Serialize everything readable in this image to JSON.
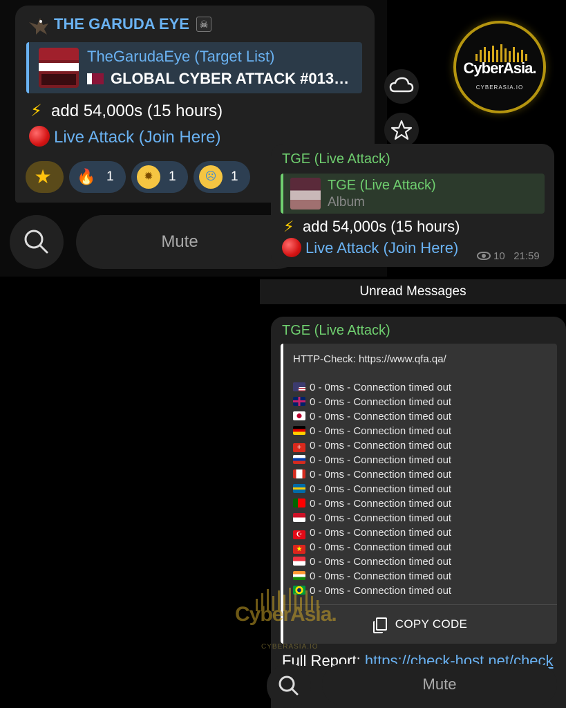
{
  "left_chat": {
    "channel_name": "THE GARUDA EYE",
    "reply": {
      "title": "TheGarudaEye (Target List)",
      "text": "GLOBAL CYBER ATTACK #013…"
    },
    "lines": [
      {
        "icon": "lightning-icon",
        "text": "add 54,000s (15 hours)"
      },
      {
        "icon": "red-circle-icon",
        "text": "Live Attack (Join Here)"
      }
    ],
    "reactions": [
      {
        "icon": "star-icon",
        "count": ""
      },
      {
        "icon": "fire-icon",
        "count": "1"
      },
      {
        "icon": "mind-blown-icon",
        "count": "1"
      },
      {
        "icon": "crying-icon",
        "count": "1"
      }
    ],
    "mute_label": "Mute"
  },
  "logo": {
    "brand": "CyberAsia.",
    "domain": "CYBERASIA.IO",
    "color": "#b5950f"
  },
  "right_chat": {
    "message1": {
      "sender": "TGE (Live Attack)",
      "reply_title": "TGE (Live Attack)",
      "reply_subtitle": "Album",
      "line1": "add 54,000s (15 hours)",
      "line2": "Live Attack (Join Here)",
      "views": "10",
      "time": "21:59"
    },
    "unread_label": "Unread Messages",
    "message2": {
      "sender": "TGE (Live Attack)",
      "code_header": "HTTP-Check: https://www.qfa.qa/",
      "rows": [
        {
          "flag": "us-flag-icon",
          "text": "0 - 0ms - Connection timed out"
        },
        {
          "flag": "uk-flag-icon",
          "text": "0 - 0ms - Connection timed out"
        },
        {
          "flag": "jp-flag-icon",
          "text": "0 - 0ms - Connection timed out"
        },
        {
          "flag": "de-flag-icon",
          "text": "0 - 0ms - Connection timed out"
        },
        {
          "flag": "ch-flag-icon",
          "text": "0 - 0ms - Connection timed out"
        },
        {
          "flag": "ru-flag-icon",
          "text": "0 - 0ms - Connection timed out"
        },
        {
          "flag": "ca-flag-icon",
          "text": "0 - 0ms - Connection timed out"
        },
        {
          "flag": "se-flag-icon",
          "text": "0 - 0ms - Connection timed out"
        },
        {
          "flag": "pt-flag-icon",
          "text": "0 - 0ms - Connection timed out"
        },
        {
          "flag": "id-flag-icon",
          "text": "0 - 0ms - Connection timed out"
        },
        {
          "flag": "tr-flag-icon",
          "text": "0 - 0ms - Connection timed out"
        },
        {
          "flag": "vn-flag-icon",
          "text": "0 - 0ms - Connection timed out"
        },
        {
          "flag": "sg-flag-icon",
          "text": "0 - 0ms - Connection timed out"
        },
        {
          "flag": "in-flag-icon",
          "text": "0 - 0ms - Connection timed out"
        },
        {
          "flag": "br-flag-icon",
          "text": "0 - 0ms - Connection timed out"
        }
      ],
      "copy_label": "COPY CODE",
      "full_report_label": "Full Report:",
      "full_report_link": "https://check-host.net/check"
    },
    "mute_label": "Mute"
  },
  "watermark": {
    "brand": "CyberAsia.",
    "domain": "CYBERASIA.IO"
  },
  "colors": {
    "link": "#6ab2f2",
    "sender_green": "#6fcf6f",
    "bubble": "#212121"
  }
}
